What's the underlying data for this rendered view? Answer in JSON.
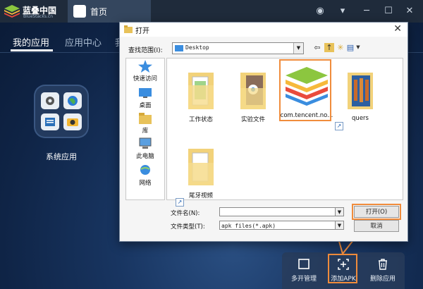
{
  "app": {
    "logo_cn": "蓝叠中国",
    "logo_en": "BlueStacks.cn",
    "home_tab": "首页"
  },
  "nav": {
    "items": [
      "我的应用",
      "应用中心",
      "我"
    ]
  },
  "system_app": {
    "label": "系统应用"
  },
  "bottom_bar": {
    "multi_open": "多开管理",
    "add_apk": "添加APK",
    "delete_app": "删除应用"
  },
  "dialog": {
    "title": "打开",
    "close": "✕",
    "look_in_label": "查找范围(I):",
    "look_in_value": "Desktop",
    "places": [
      "快速访问",
      "桌面",
      "库",
      "此电脑",
      "网络"
    ],
    "files": [
      "工作状态",
      "实验文件",
      "com.tencent.no...",
      "quers",
      "尾牙视频"
    ],
    "filename_label": "文件名(N):",
    "filename_value": "",
    "filetype_label": "文件类型(T):",
    "filetype_value": "apk files(*.apk)",
    "open_button": "打开(O)",
    "cancel_button": "取消"
  },
  "colors": {
    "highlight": "#f08c3c",
    "topbar": "#1f2b3b"
  }
}
